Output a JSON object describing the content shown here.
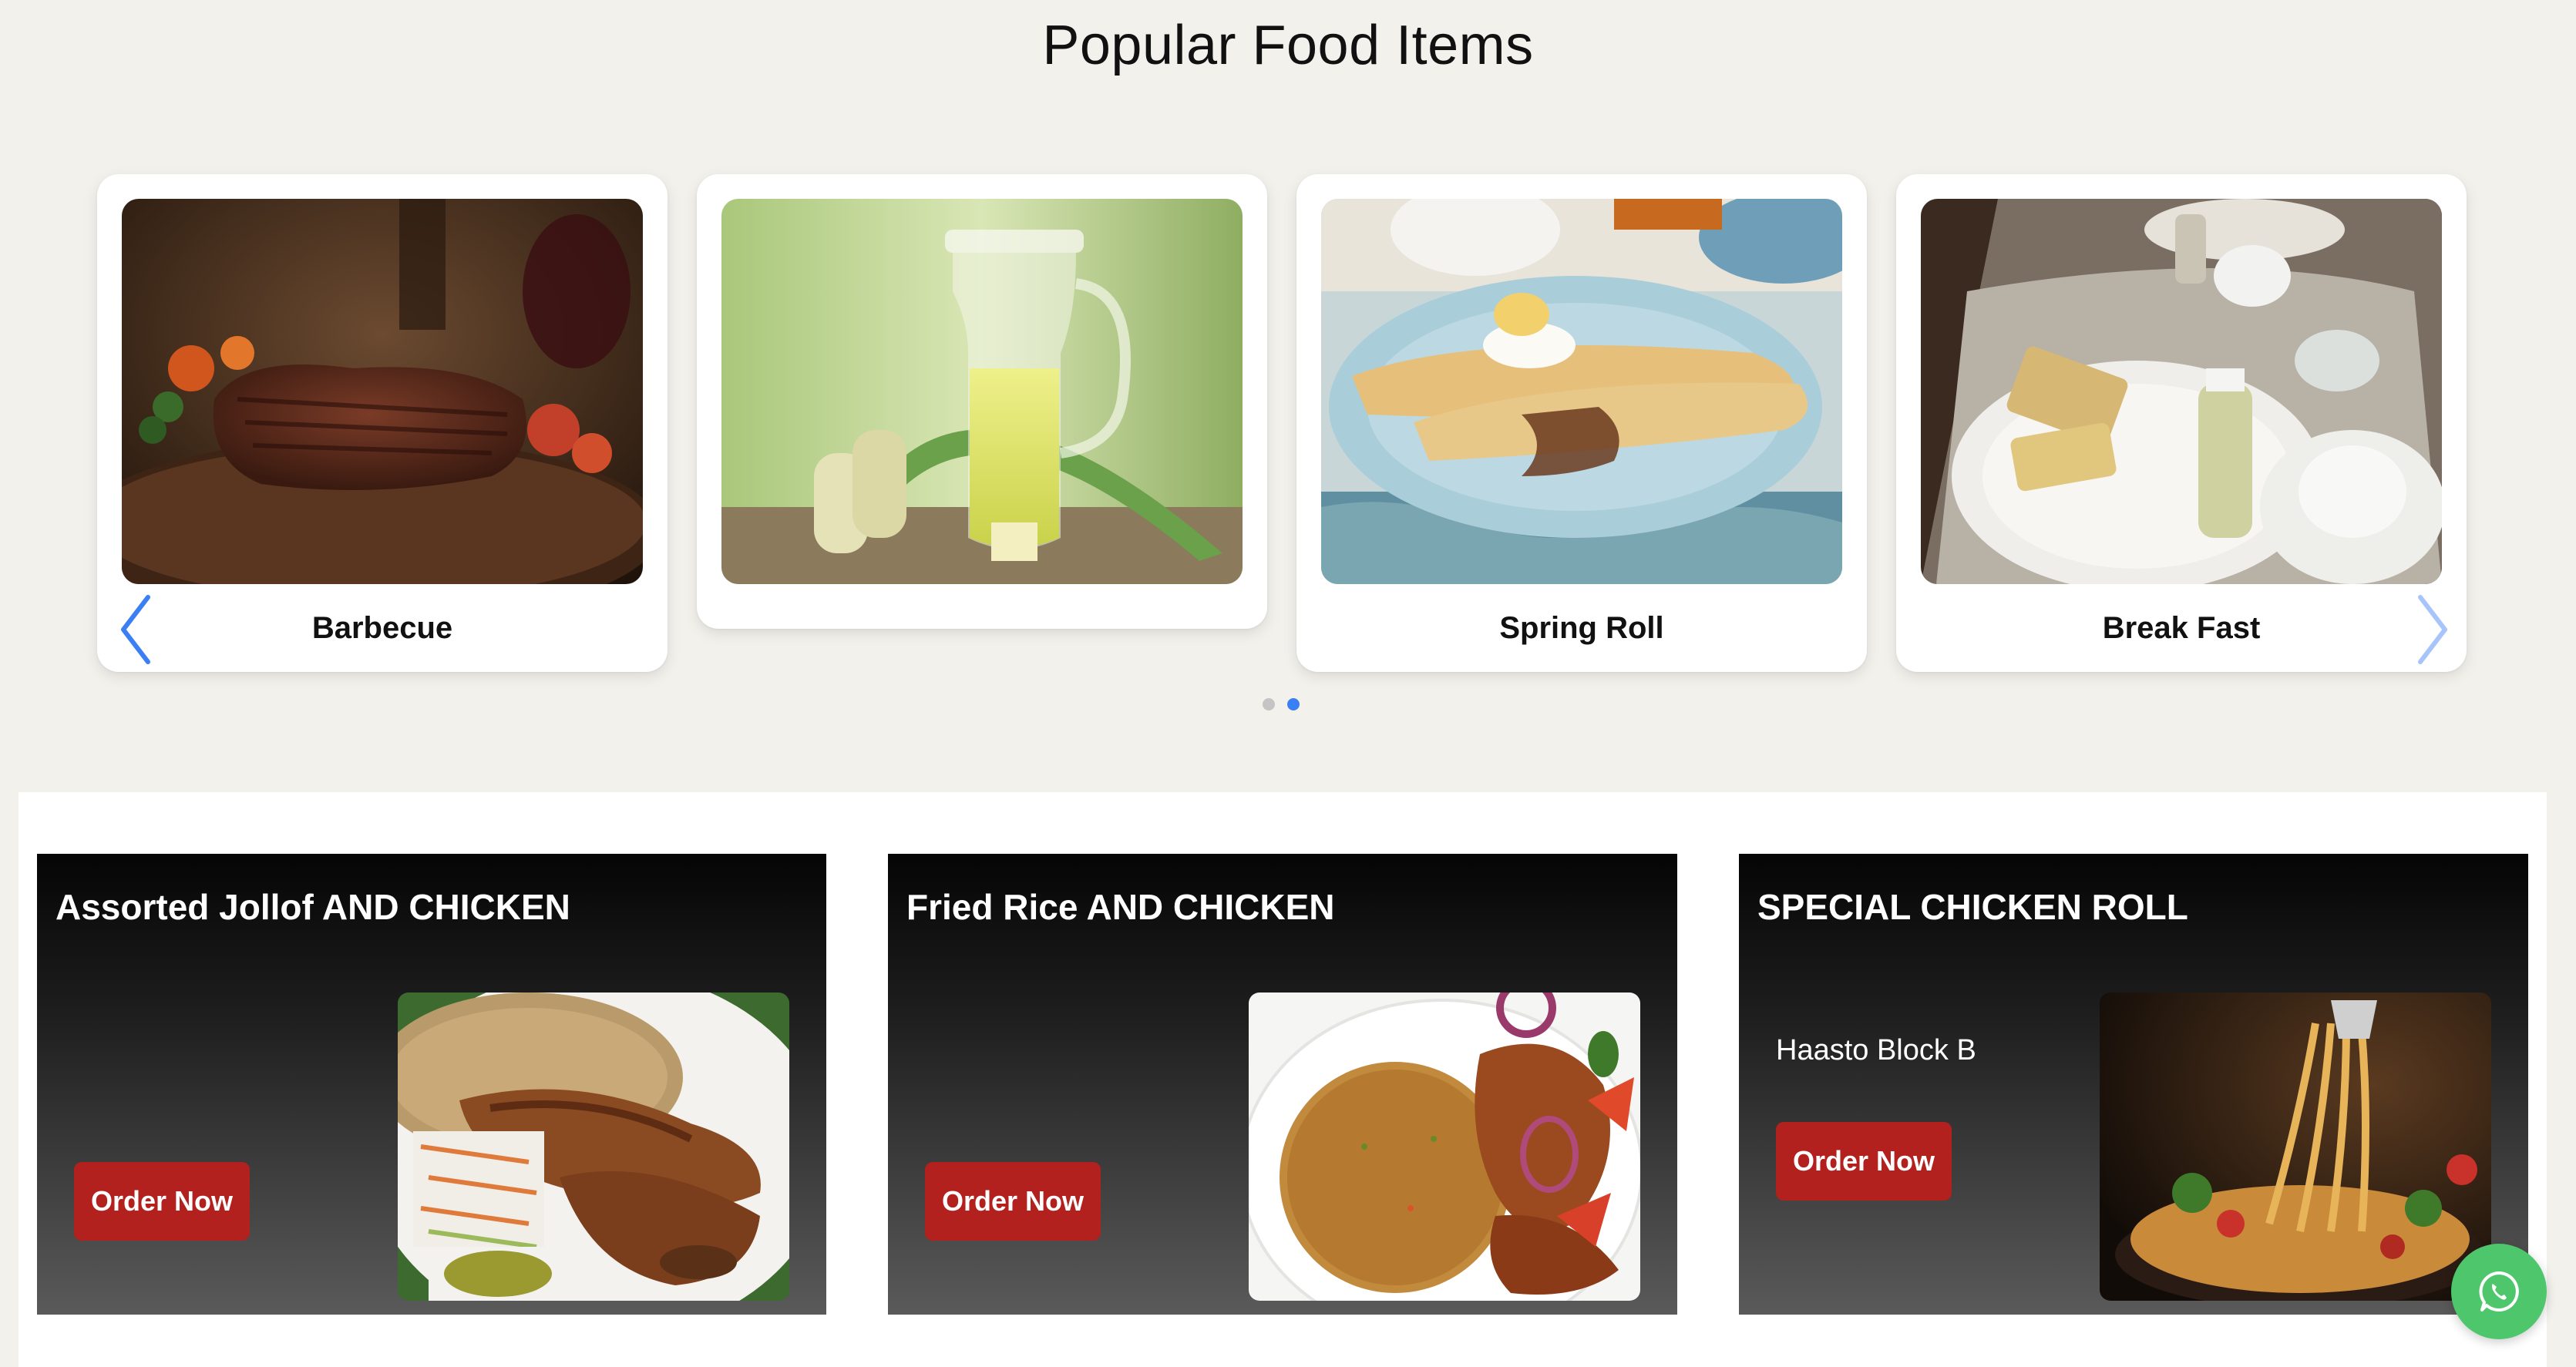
{
  "section": {
    "title": "Popular Food Items"
  },
  "carousel": {
    "items": [
      {
        "label": "Barbecue",
        "image": "barbecue-steak-image"
      },
      {
        "label": "",
        "image": "sugarcane-juice-image"
      },
      {
        "label": "Spring Roll",
        "image": "spring-roll-crepe-image"
      },
      {
        "label": "Break Fast",
        "image": "breakfast-tray-image"
      }
    ],
    "prev_icon": "chevron-left-icon",
    "next_icon": "chevron-right-icon",
    "dots": 2,
    "active_dot": 2,
    "colors": {
      "arrow": "#3b7ff5",
      "dot_active": "#3b7ff5",
      "dot_inactive": "#c4c4c4"
    }
  },
  "promos": [
    {
      "title": "Assorted Jollof AND CHICKEN",
      "location": "",
      "button": "Order Now",
      "image": "jollof-chicken-image"
    },
    {
      "title": "Fried Rice AND CHICKEN",
      "location": "",
      "button": "Order Now",
      "image": "fried-rice-chicken-image"
    },
    {
      "title": "SPECIAL CHICKEN ROLL",
      "location": "Haasto Block B",
      "button": "Order Now",
      "image": "spaghetti-image"
    }
  ],
  "colors": {
    "page_bg": "#f3f1ec",
    "order_button": "#b3211e",
    "whatsapp": "#4ec66b"
  },
  "whatsapp": {
    "icon": "whatsapp-icon"
  }
}
